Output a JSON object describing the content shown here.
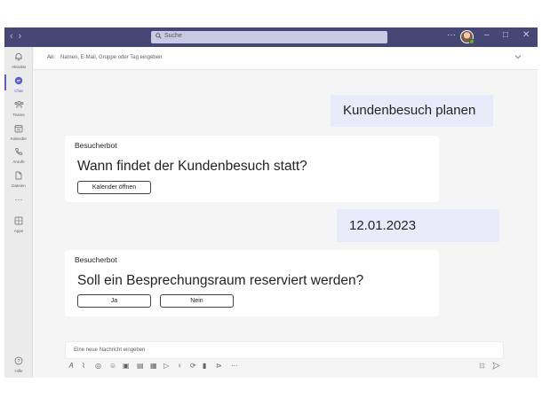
{
  "titlebar": {
    "nav_back": "‹",
    "nav_forward": "›",
    "search_icon": "search-icon",
    "search_placeholder": "Suche",
    "more": "···",
    "minimize": "–",
    "maximize": "□",
    "close": "✕"
  },
  "sidebar": {
    "items": [
      {
        "label": "Aktivität",
        "icon": "bell-icon",
        "glyph": "🔔"
      },
      {
        "label": "Chat",
        "icon": "chat-icon",
        "glyph": "💬"
      },
      {
        "label": "Teams",
        "icon": "teams-icon",
        "glyph": "👥"
      },
      {
        "label": "Kalender",
        "icon": "calendar-icon",
        "glyph": "▦"
      },
      {
        "label": "Anrufe",
        "icon": "phone-icon",
        "glyph": "✆"
      },
      {
        "label": "Dateien",
        "icon": "file-icon",
        "glyph": "🗋"
      },
      {
        "label": "···",
        "icon": "more-icon",
        "glyph": ""
      },
      {
        "label": "Apps",
        "icon": "apps-icon",
        "glyph": "▦"
      }
    ],
    "help": {
      "label": "Hilfe",
      "icon": "help-icon",
      "glyph": "?"
    },
    "active_color": "#5b5fc7"
  },
  "header": {
    "to_label": "An:",
    "to_placeholder": "Namen, E-Mail, Gruppe oder Tag eingeben",
    "expand_icon": "chevron-down-icon"
  },
  "messages": [
    {
      "type": "outgoing",
      "text": "Kundenbesuch planen"
    },
    {
      "type": "card",
      "sender": "Besucherbot",
      "question": "Wann findet der Kundenbesuch statt?",
      "buttons": [
        "Kalender öffnen"
      ]
    },
    {
      "type": "outgoing",
      "text": "12.01.2023"
    },
    {
      "type": "card",
      "sender": "Besucherbot",
      "question": "Soll ein Besprechungsraum reserviert werden?",
      "buttons": [
        "Ja",
        "Nein"
      ]
    }
  ],
  "compose": {
    "placeholder": "Eine neue Nachricht eingeben",
    "toolbar_icons": [
      "format-icon",
      "attach-icon",
      "loop-icon",
      "emoji-icon",
      "gif-icon",
      "sticker-icon",
      "schedule-icon",
      "stream-icon",
      "praise-icon",
      "meet-icon",
      "approvals-icon",
      "visio-icon",
      "more-icon"
    ],
    "send_icons": [
      "schedule-send-icon",
      "send-icon"
    ]
  },
  "colors": {
    "titlebar": "#464775",
    "accent": "#5b5fc7",
    "outgoing_bubble": "#e8ebfa",
    "card": "#ffffff",
    "canvas": "#f5f5f5"
  }
}
